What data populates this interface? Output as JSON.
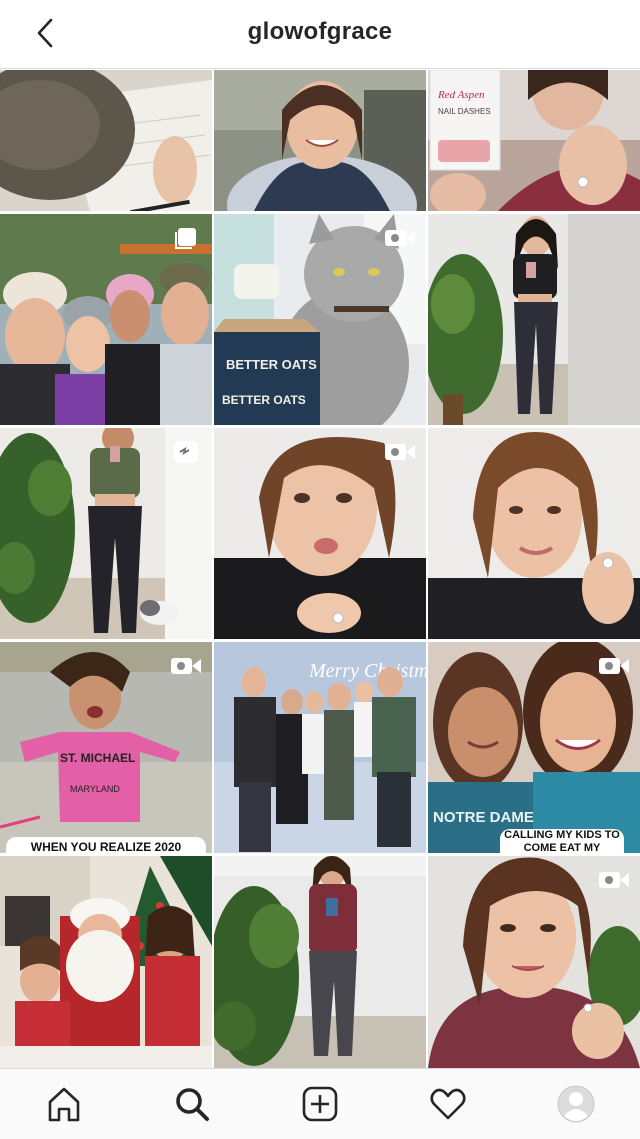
{
  "header": {
    "username": "glowofgrace"
  },
  "grid": {
    "tiles": [
      {
        "name": "post-notebook-writing",
        "badge": "",
        "caption": ""
      },
      {
        "name": "post-woman-vest-selfie",
        "badge": "",
        "caption": ""
      },
      {
        "name": "post-nail-dashes",
        "badge": "",
        "caption": "",
        "text": "NAIL DASHES"
      },
      {
        "name": "post-family-selfie",
        "badge": "carousel",
        "caption": ""
      },
      {
        "name": "post-cat-better-oats",
        "badge": "video",
        "caption": "",
        "text": "BETTER OATS"
      },
      {
        "name": "post-mirror-outfit",
        "badge": "",
        "caption": ""
      },
      {
        "name": "post-leggings-cat",
        "badge": "igtv",
        "caption": ""
      },
      {
        "name": "post-woman-pout",
        "badge": "video",
        "caption": ""
      },
      {
        "name": "post-woman-smile-ring",
        "badge": "",
        "caption": ""
      },
      {
        "name": "post-girl-jumping",
        "badge": "video",
        "caption": "WHEN YOU REALIZE 2020"
      },
      {
        "name": "post-merry-christmas-family",
        "badge": "",
        "caption": "",
        "text": "Merry Christmas"
      },
      {
        "name": "post-mother-daughter",
        "badge": "video",
        "caption": "CALLING MY KIDS TO COME EAT MY DELICIOUS"
      },
      {
        "name": "post-santa-kids",
        "badge": "",
        "caption": ""
      },
      {
        "name": "post-burgundy-sweater-mirror",
        "badge": "",
        "caption": ""
      },
      {
        "name": "post-woman-burgundy-closeup",
        "badge": "video",
        "caption": ""
      }
    ]
  },
  "tabbar": {
    "items": [
      {
        "name": "home"
      },
      {
        "name": "search"
      },
      {
        "name": "new-post"
      },
      {
        "name": "activity"
      },
      {
        "name": "profile"
      }
    ]
  }
}
